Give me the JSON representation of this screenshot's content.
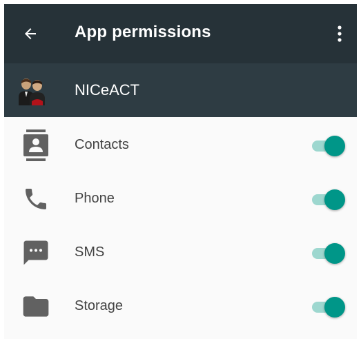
{
  "toolbar": {
    "title": "App permissions",
    "back_icon": "arrow-back-icon",
    "menu_icon": "more-vert-icon"
  },
  "app": {
    "name": "NICeACT",
    "icon": "people-avatar-icon"
  },
  "permissions": [
    {
      "label": "Contacts",
      "icon": "contacts-icon",
      "enabled": true
    },
    {
      "label": "Phone",
      "icon": "phone-icon",
      "enabled": true
    },
    {
      "label": "SMS",
      "icon": "sms-icon",
      "enabled": true
    },
    {
      "label": "Storage",
      "icon": "folder-icon",
      "enabled": true
    }
  ],
  "colors": {
    "toolbar": "#263238",
    "app_header": "#2e3c43",
    "accent": "#009688",
    "accent_track": "#9dd7cf"
  }
}
